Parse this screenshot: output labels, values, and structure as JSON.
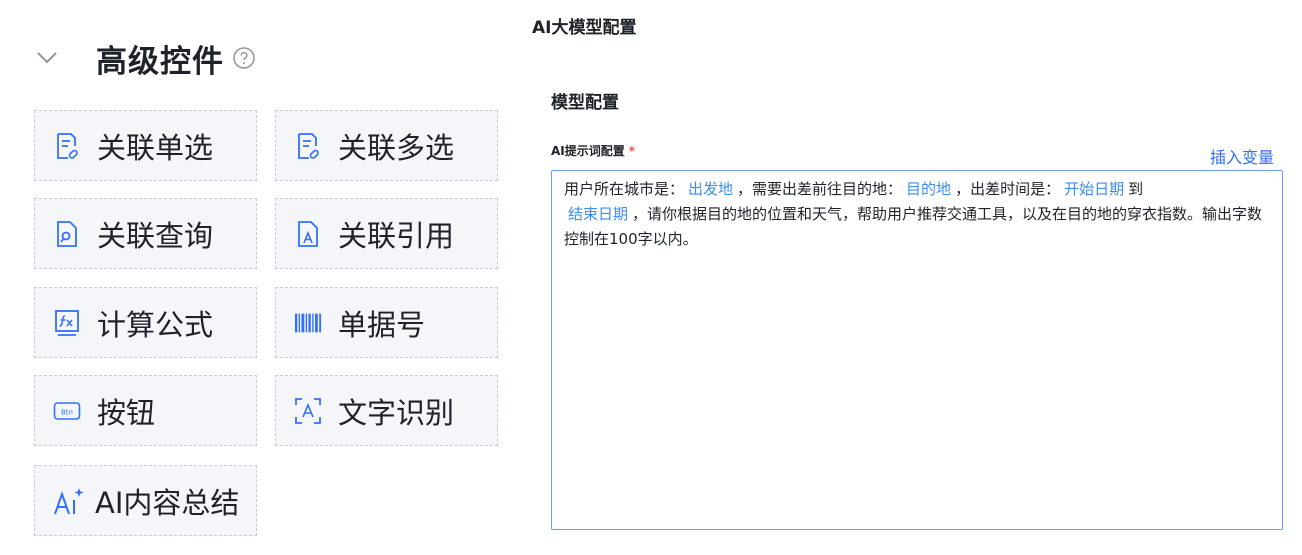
{
  "left_panel": {
    "section_title": "高级控件",
    "controls": [
      {
        "label": "关联单选",
        "icon": "linked-single-select-icon"
      },
      {
        "label": "关联多选",
        "icon": "linked-multi-select-icon"
      },
      {
        "label": "关联查询",
        "icon": "linked-query-icon"
      },
      {
        "label": "关联引用",
        "icon": "linked-reference-icon"
      },
      {
        "label": "计算公式",
        "icon": "formula-icon"
      },
      {
        "label": "单据号",
        "icon": "barcode-icon"
      },
      {
        "label": "按钮",
        "icon": "button-icon"
      },
      {
        "label": "文字识别",
        "icon": "text-recognition-icon"
      },
      {
        "label": "AI内容总结",
        "icon": "ai-sparkle-icon"
      }
    ]
  },
  "right_panel": {
    "page_title": "AI大模型配置",
    "sub_title": "模型配置",
    "field_label": "AI提示词配置",
    "required_mark": "*",
    "insert_variable": "插入变量",
    "prompt": {
      "t1": "用户所在城市是：",
      "v1": "出发地",
      "t2": "，需要出差前往目的地：",
      "v2": "目的地",
      "t3": "，出差时间是：",
      "v3": "开始日期",
      "t4": "到",
      "v4": "结束日期",
      "t5": "，请你根据目的地的位置和天气，帮助用户推荐交通工具，以及在目的地的穿衣指数。输出字数控制在100字以内。"
    }
  },
  "colors": {
    "accent": "#3370ff",
    "variable": "#3a8ef6",
    "required": "#f54a45",
    "control_bg": "#f5f6fa",
    "control_border": "#c9cedb",
    "icon": "#3370ff"
  }
}
